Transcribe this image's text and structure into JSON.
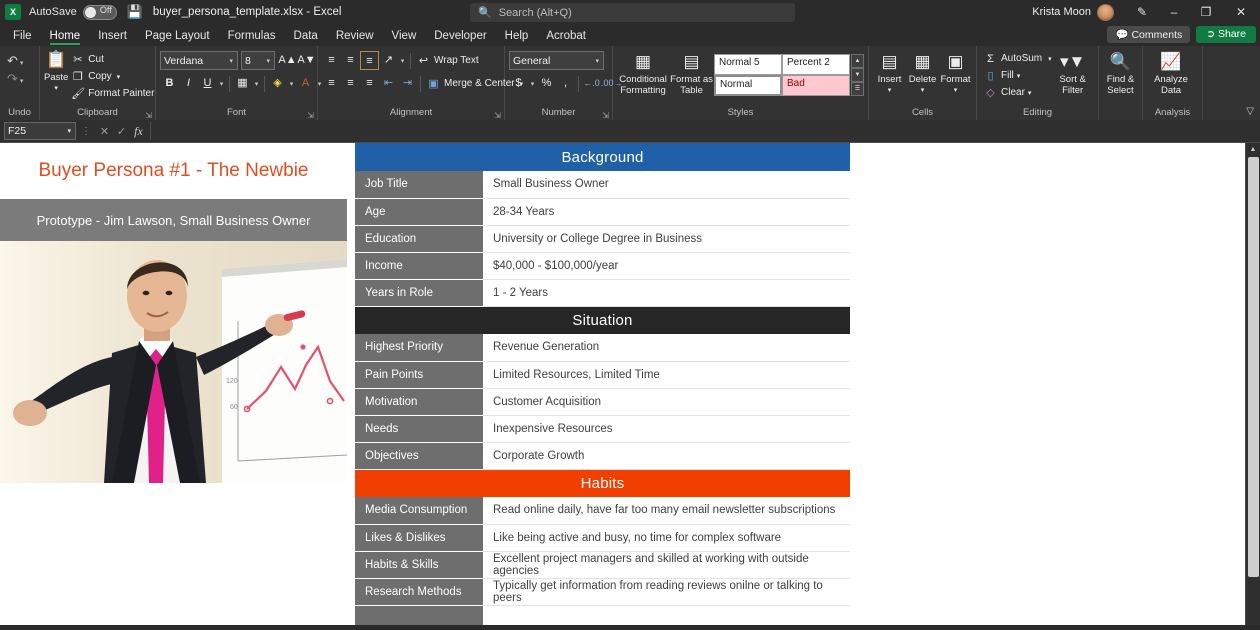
{
  "titlebar": {
    "app_icon": "excel-logo",
    "autosave_label": "AutoSave",
    "autosave_state": "Off",
    "save_icon": "save-icon",
    "filename": "buyer_persona_template.xlsx  -  Excel",
    "user_name": "Krista Moon",
    "pen_icon": "pen-icon",
    "minimize_icon": "–",
    "restore_icon": "❐",
    "close_icon": "✕"
  },
  "search": {
    "placeholder": "Search (Alt+Q)",
    "value": "",
    "icon": "search-icon"
  },
  "ribbon_actions": {
    "comments_label": "Comments",
    "share_label": "Share"
  },
  "tabs": [
    {
      "label": "File",
      "active": false
    },
    {
      "label": "Home",
      "active": true
    },
    {
      "label": "Insert",
      "active": false
    },
    {
      "label": "Page Layout",
      "active": false
    },
    {
      "label": "Formulas",
      "active": false
    },
    {
      "label": "Data",
      "active": false
    },
    {
      "label": "Review",
      "active": false
    },
    {
      "label": "View",
      "active": false
    },
    {
      "label": "Developer",
      "active": false
    },
    {
      "label": "Help",
      "active": false
    },
    {
      "label": "Acrobat",
      "active": false
    }
  ],
  "ribbon": {
    "undo": {
      "group_label": "Undo",
      "undo_icon": "undo-arrow-icon",
      "redo_icon": "redo-arrow-icon"
    },
    "clipboard": {
      "group_label": "Clipboard",
      "paste_label": "Paste",
      "cut_label": "Cut",
      "copy_label": "Copy",
      "format_painter_label": "Format Painter"
    },
    "font": {
      "group_label": "Font",
      "font_name": "Verdana",
      "font_size": "8",
      "grow_font_icon": "grow-font-icon",
      "shrink_font_icon": "shrink-font-icon",
      "bold_label": "B",
      "italic_label": "I",
      "underline_label": "U",
      "borders_icon": "borders-icon",
      "fill_color_icon": "fill-color-icon",
      "font_color_icon": "font-color-icon"
    },
    "alignment": {
      "group_label": "Alignment",
      "wrap_text_label": "Wrap Text",
      "merge_center_label": "Merge & Center",
      "orientation_icon": "orientation-icon",
      "indent_decrease_icon": "decrease-indent-icon",
      "indent_increase_icon": "increase-indent-icon"
    },
    "number": {
      "group_label": "Number",
      "format": "General",
      "currency_icon": "currency-icon",
      "percent_icon": "percent-icon",
      "comma_icon": "comma-icon",
      "increase_decimal_icon": "increase-decimal-icon",
      "decrease_decimal_icon": "decrease-decimal-icon"
    },
    "styles": {
      "group_label": "Styles",
      "conditional_formatting_label": "Conditional Formatting",
      "format_as_table_label": "Format as Table",
      "gallery": [
        "Normal 5",
        "Percent 2",
        "Normal",
        "Bad"
      ]
    },
    "cells": {
      "group_label": "Cells",
      "insert_label": "Insert",
      "delete_label": "Delete",
      "format_label": "Format"
    },
    "editing": {
      "group_label": "Editing",
      "autosum_label": "AutoSum",
      "fill_label": "Fill",
      "clear_label": "Clear",
      "sort_filter_label": "Sort & Filter",
      "find_select_label": "Find & Select"
    },
    "analysis": {
      "group_label": "Analysis",
      "analyze_data_label": "Analyze Data"
    },
    "collapse_icon": "chevron-up-icon"
  },
  "formula_bar": {
    "name_box": "F25",
    "cancel_icon": "✕",
    "confirm_icon": "✓",
    "fx_icon": "fx",
    "formula_value": ""
  },
  "persona": {
    "title": "Buyer Persona #1 - The Newbie",
    "subtitle": "Prototype - Jim Lawson, Small Business Owner",
    "photo_alt": "businessman-pointing-at-chart-photo"
  },
  "sections": [
    {
      "header": "Background",
      "header_color": "#1F60A8",
      "rows": [
        {
          "label": "Job Title",
          "value": "Small Business Owner"
        },
        {
          "label": "Age",
          "value": "28-34 Years"
        },
        {
          "label": "Education",
          "value": "University or College Degree in Business"
        },
        {
          "label": "Income",
          "value": "$40,000 - $100,000/year"
        },
        {
          "label": "Years in Role",
          "value": "1 - 2 Years"
        }
      ]
    },
    {
      "header": "Situation",
      "header_color": "#262626",
      "rows": [
        {
          "label": "Highest Priority",
          "value": "Revenue Generation"
        },
        {
          "label": "Pain Points",
          "value": "Limited Resources, Limited Time"
        },
        {
          "label": "Motivation",
          "value": "Customer Acquisition"
        },
        {
          "label": "Needs",
          "value": "Inexpensive Resources"
        },
        {
          "label": "Objectives",
          "value": "Corporate Growth"
        }
      ]
    },
    {
      "header": "Habits",
      "header_color": "#F03F00",
      "rows": [
        {
          "label": "Media Consumption",
          "value": "Read online daily, have far too many email newsletter subscriptions"
        },
        {
          "label": "Likes & Dislikes",
          "value": "Like being active and busy, no time for complex software"
        },
        {
          "label": "Habits & Skills",
          "value": "Excellent project managers and skilled at working with outside agencies"
        },
        {
          "label": "Research Methods",
          "value": "Typically get information from reading reviews onilne or talking to peers"
        },
        {
          "label": "",
          "value": ""
        }
      ]
    }
  ],
  "scrollbar": {
    "up_icon": "▲",
    "down_icon": "▼"
  }
}
